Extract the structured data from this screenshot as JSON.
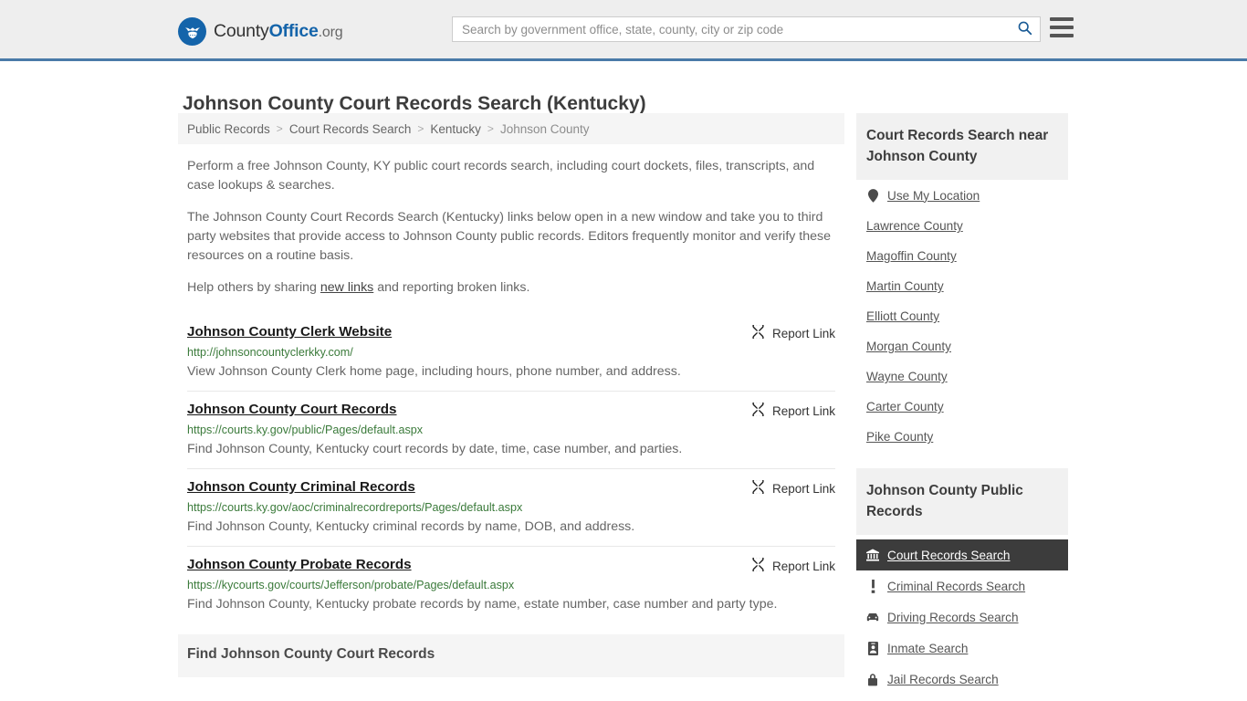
{
  "header": {
    "logo": {
      "icon": "eagle-shield-logo",
      "part1": "County",
      "part2": "Office",
      "part3": ".org"
    },
    "search": {
      "placeholder": "Search by government office, state, county, city or zip code",
      "value": "",
      "icon": "search-icon"
    },
    "menu_icon": "hamburger-menu-icon"
  },
  "page": {
    "title": "Johnson County Court Records Search (Kentucky)"
  },
  "breadcrumb": {
    "items": [
      {
        "label": "Public Records",
        "current": false
      },
      {
        "label": "Court Records Search",
        "current": false
      },
      {
        "label": "Kentucky",
        "current": false
      },
      {
        "label": "Johnson County",
        "current": true
      }
    ],
    "separator": ">"
  },
  "intro": {
    "paragraph1": "Perform a free Johnson County, KY public court records search, including court dockets, files, transcripts, and case lookups & searches.",
    "paragraph2": "The Johnson County Court Records Search (Kentucky) links below open in a new window and take you to third party websites that provide access to Johnson County public records. Editors frequently monitor and verify these resources on a routine basis.",
    "paragraph3_before": "Help others by sharing ",
    "paragraph3_link": "new links",
    "paragraph3_after": " and reporting broken links."
  },
  "report_link_label": "Report Link",
  "report_link_icon": "broken-link-icon",
  "links": [
    {
      "title": "Johnson County Clerk Website",
      "url": "http://johnsoncountyclerkky.com/",
      "description": "View Johnson County Clerk home page, including hours, phone number, and address."
    },
    {
      "title": "Johnson County Court Records",
      "url": "https://courts.ky.gov/public/Pages/default.aspx",
      "description": "Find Johnson County, Kentucky court records by date, time, case number, and parties."
    },
    {
      "title": "Johnson County Criminal Records",
      "url": "https://courts.ky.gov/aoc/criminalrecordreports/Pages/default.aspx",
      "description": "Find Johnson County, Kentucky criminal records by name, DOB, and address."
    },
    {
      "title": "Johnson County Probate Records",
      "url": "https://kycourts.gov/courts/Jefferson/probate/Pages/default.aspx",
      "description": "Find Johnson County, Kentucky probate records by name, estate number, case number and party type."
    }
  ],
  "bottom_section": {
    "heading": "Find Johnson County Court Records"
  },
  "aside": {
    "nearby": {
      "heading": "Court Records Search near Johnson County",
      "items": [
        {
          "label": "Use My Location",
          "icon": "map-pin-icon"
        },
        {
          "label": "Lawrence County",
          "icon": null
        },
        {
          "label": "Magoffin County",
          "icon": null
        },
        {
          "label": "Martin County",
          "icon": null
        },
        {
          "label": "Elliott County",
          "icon": null
        },
        {
          "label": "Morgan County",
          "icon": null
        },
        {
          "label": "Wayne County",
          "icon": null
        },
        {
          "label": "Carter County",
          "icon": null
        },
        {
          "label": "Pike County",
          "icon": null
        }
      ]
    },
    "public_records": {
      "heading": "Johnson County Public Records",
      "items": [
        {
          "label": "Court Records Search",
          "icon": "courthouse-icon",
          "active": true
        },
        {
          "label": "Criminal Records Search",
          "icon": "exclamation-icon",
          "active": false
        },
        {
          "label": "Driving Records Search",
          "icon": "car-icon",
          "active": false
        },
        {
          "label": "Inmate Search",
          "icon": "id-card-icon",
          "active": false
        },
        {
          "label": "Jail Records Search",
          "icon": "lock-icon",
          "active": false
        }
      ]
    }
  },
  "colors": {
    "brand_blue": "#1464aa",
    "header_bg": "#eeeeee",
    "header_border": "#4a7aa8",
    "url_green": "#3a7a3a",
    "active_bg": "#3c3c3c",
    "panel_gray": "#f1f1f1"
  }
}
